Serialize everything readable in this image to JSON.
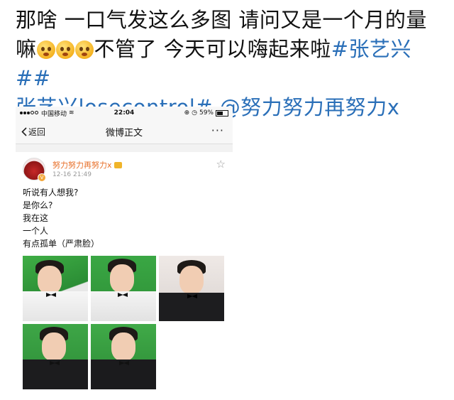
{
  "post": {
    "line1": "那啥 一口气发这么多图 请问又是一个月的量",
    "line2_prefix": "嘛",
    "line2_after_emoji": "不管了 今天可以嗨起来啦",
    "hashtag1": "#张艺兴##",
    "hashtag2": "张艺兴losecontrol#",
    "mention": " @努力努力再努力x",
    "emoji_names": [
      "crying-face",
      "crying-face",
      "crying-face"
    ]
  },
  "screenshot": {
    "statusbar": {
      "carrier": "中国移动",
      "time": "22:04",
      "battery": "59%",
      "icons": [
        "signal-dots",
        "wifi-icon",
        "lock-rotation-icon",
        "alarm-icon",
        "battery-icon"
      ]
    },
    "navbar": {
      "back_label": "返回",
      "title": "微博正文",
      "more": "···"
    },
    "weibo": {
      "username": "努力努力再努力x",
      "timestamp": "12-16 21:49",
      "lines": [
        "听说有人想我?",
        "是你么?",
        "我在这",
        "一个人",
        "有点孤单（严肃脸）"
      ],
      "photo_count": 5
    }
  },
  "colors": {
    "link": "#2a6fb8",
    "username": "#e8702a",
    "green_screen": "#2f9a3a"
  }
}
